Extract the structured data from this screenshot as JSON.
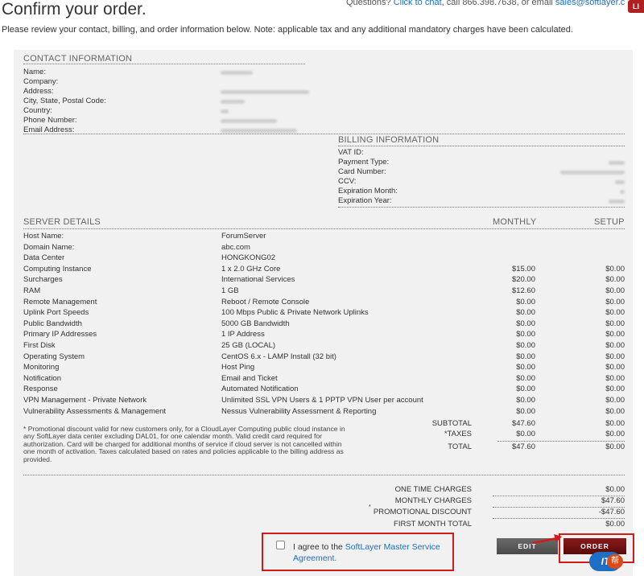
{
  "header": {
    "title": "Confirm your order.",
    "questions_prefix": "Questions?",
    "chat_link": "Click to chat",
    "call_text": ", call 866.398.7638, or email",
    "email_link": "sales@softlayer.c",
    "badge": "LI"
  },
  "intro": "Please review your contact, billing, and order information below. Note: applicable tax and any additional mandatory charges have been calculated.",
  "contact": {
    "heading": "CONTACT INFORMATION",
    "labels": [
      "Name:",
      "Company:",
      "Address:",
      "City, State, Postal Code:",
      "Country:",
      "Phone Number:",
      "Email Address:"
    ]
  },
  "billing": {
    "heading": "BILLING INFORMATION",
    "labels": [
      "VAT ID:",
      "Payment Type:",
      "Card Number:",
      "CCV:",
      "Expiration Month:",
      "Expiration Year:"
    ]
  },
  "server": {
    "heading": "SERVER DETAILS",
    "monthly_heading": "MONTHLY",
    "setup_heading": "SETUP",
    "rows": [
      {
        "name": "Host Name:",
        "value": "ForumServer",
        "monthly": "",
        "setup": ""
      },
      {
        "name": "Domain Name:",
        "value": "abc.com",
        "monthly": "",
        "setup": ""
      },
      {
        "name": "Data Center",
        "value": "HONGKONG02",
        "monthly": "",
        "setup": ""
      },
      {
        "name": "Computing Instance",
        "value": "1 x 2.0 GHz Core",
        "monthly": "$15.00",
        "setup": "$0.00"
      },
      {
        "name": "Surcharges",
        "value": "International Services",
        "monthly": "$20.00",
        "setup": "$0.00"
      },
      {
        "name": "RAM",
        "value": "1 GB",
        "monthly": "$12.60",
        "setup": "$0.00"
      },
      {
        "name": "Remote Management",
        "value": "Reboot / Remote Console",
        "monthly": "$0.00",
        "setup": "$0.00"
      },
      {
        "name": "Uplink Port Speeds",
        "value": "100 Mbps Public & Private Network Uplinks",
        "monthly": "$0.00",
        "setup": "$0.00"
      },
      {
        "name": "Public Bandwidth",
        "value": "5000 GB Bandwidth",
        "monthly": "$0.00",
        "setup": "$0.00"
      },
      {
        "name": "Primary IP Addresses",
        "value": "1 IP Address",
        "monthly": "$0.00",
        "setup": "$0.00"
      },
      {
        "name": "First Disk",
        "value": "25 GB (LOCAL)",
        "monthly": "$0.00",
        "setup": "$0.00"
      },
      {
        "name": "Operating System",
        "value": "CentOS 6.x - LAMP Install (32 bit)",
        "monthly": "$0.00",
        "setup": "$0.00"
      },
      {
        "name": "Monitoring",
        "value": "Host Ping",
        "monthly": "$0.00",
        "setup": "$0.00"
      },
      {
        "name": "Notification",
        "value": "Email and Ticket",
        "monthly": "$0.00",
        "setup": "$0.00"
      },
      {
        "name": "Response",
        "value": "Automated Notification",
        "monthly": "$0.00",
        "setup": "$0.00"
      },
      {
        "name": "VPN Management - Private Network",
        "value": "Unlimited SSL VPN Users & 1 PPTP VPN User per account",
        "monthly": "$0.00",
        "setup": "$0.00"
      },
      {
        "name": "Vulnerability Assessments & Management",
        "value": "Nessus Vulnerability Assessment & Reporting",
        "monthly": "$0.00",
        "setup": "$0.00"
      }
    ]
  },
  "promo_note": "* Promotional discount valid for new customers only, for a CloudLayer Computing public cloud instance in any SoftLayer data center excluding DAL01, for one calendar month. Valid credit card required for authorization. Card will be charged for additional months of service if cloud server is not cancelled within one month of activation. Taxes calculated based on rates and policies applicable to the billing address as provided.",
  "totals": [
    {
      "label": "SUBTOTAL",
      "monthly": "$47.60",
      "setup": "$0.00"
    },
    {
      "label": "*TAXES",
      "monthly": "$0.00",
      "setup": "$0.00"
    },
    {
      "label": "TOTAL",
      "monthly": "$47.60",
      "setup": "$0.00"
    }
  ],
  "charges": [
    {
      "label": "ONE TIME CHARGES",
      "value": "$0.00"
    },
    {
      "label": "MONTHLY CHARGES",
      "value": "$47.60"
    },
    {
      "label": "PROMOTIONAL DISCOUNT",
      "value": "-$47.60"
    },
    {
      "label": "FIRST MONTH TOTAL",
      "value": "$0.00"
    }
  ],
  "promo_star": "*",
  "agree": {
    "prefix": "I agree to the ",
    "link": "SoftLayer Master Service Agreement."
  },
  "buttons": {
    "edit": "EDIT",
    "order": "ORDER"
  },
  "watermark": {
    "text": "IT",
    "sub": "帮"
  },
  "colors": {
    "accent_red": "#d21a1a",
    "link": "#1a6fc4",
    "panel": "#f1f1f1",
    "edit_button": "#5a5a5a",
    "order_button": "#7a1010"
  }
}
